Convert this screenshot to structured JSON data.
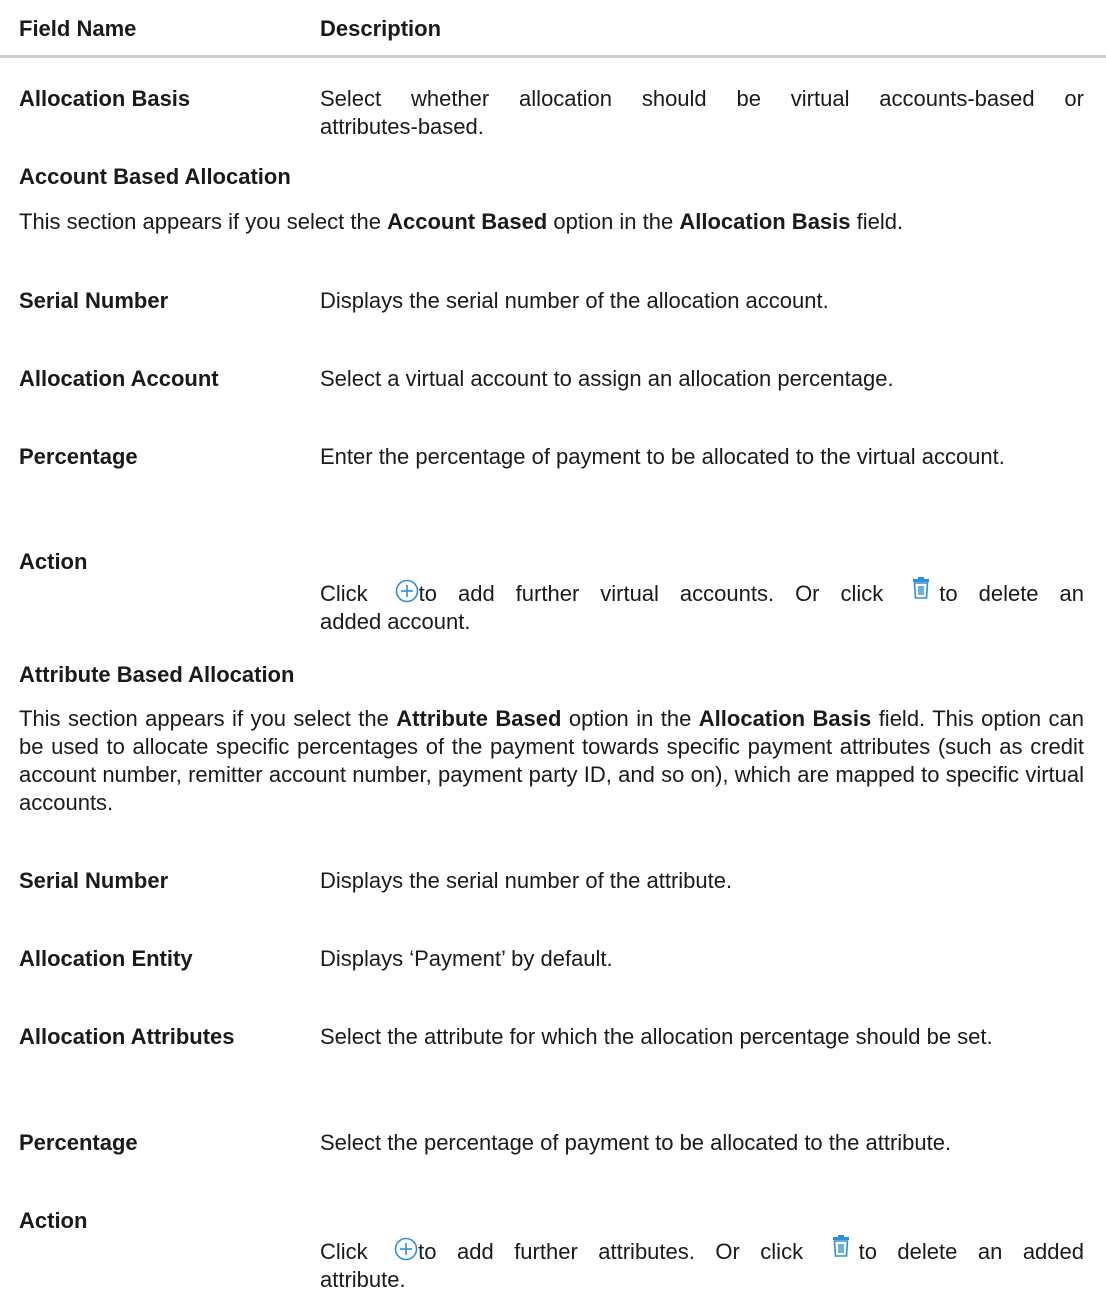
{
  "table_header": {
    "field_name": "Field Name",
    "description": "Description"
  },
  "allocation_basis": {
    "field": "Allocation Basis",
    "desc_line1": "Select whether allocation should be virtual accounts-based or",
    "desc_line2": "attributes-based."
  },
  "account_section": {
    "title": "Account Based Allocation",
    "para_pre": "This section appears if you select the ",
    "para_b1": "Account Based",
    "para_mid": " option in the ",
    "para_b2": "Allocation Basis",
    "para_post": " field.",
    "rows": [
      {
        "field": "Serial Number",
        "desc": "Displays the serial number of the allocation account."
      },
      {
        "field": "Allocation Account",
        "desc": "Select a virtual account to assign an allocation percentage."
      },
      {
        "field": "Percentage",
        "desc": "Enter the percentage of payment to be allocated to the virtual account."
      }
    ],
    "action": {
      "field": "Action",
      "click1": "Click ",
      "after_add": "to add further virtual accounts. Or click ",
      "after_delete": "to delete an",
      "line2": "added account."
    }
  },
  "attribute_section": {
    "title": "Attribute Based Allocation",
    "para_pre": "This section appears if you select the ",
    "para_b1": "Attribute Based",
    "para_mid": " option in the ",
    "para_b2": "Allocation Basis",
    "para_post": " field. This option can be used to allocate specific percentages of the payment towards specific payment attributes (such as credit account number, remitter account number, payment party ID, and so on), which are mapped to specific virtual accounts.",
    "rows": [
      {
        "field": "Serial Number",
        "desc": "Displays the serial number of the attribute."
      },
      {
        "field": "Allocation Entity",
        "desc": "Displays ‘Payment’ by default."
      },
      {
        "field": "Allocation Attributes",
        "desc": "Select the attribute for which the allocation percentage should be set."
      },
      {
        "field": "Percentage",
        "desc": "Select the percentage of payment to be allocated to the attribute."
      }
    ],
    "action": {
      "field": "Action",
      "click1": "Click ",
      "after_add": "to add further attributes. Or click ",
      "after_delete": "to delete an added",
      "line2": "attribute."
    }
  },
  "icons": {
    "add": "add-circle-icon",
    "delete": "trash-icon",
    "icon_color": "#2e8fd6"
  }
}
